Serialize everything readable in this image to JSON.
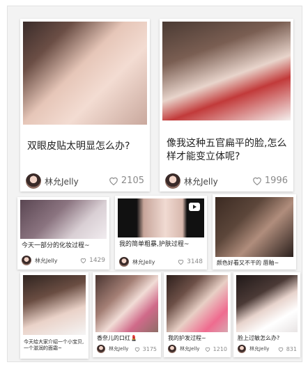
{
  "cards": [
    {
      "caption": "双眼皮贴太明显怎么办?",
      "author": "林允Jelly",
      "likes": "2105",
      "heart_icon": "heart-outline-icon"
    },
    {
      "caption": "像我这种五官扁平的脸,怎么样才能变立体呢?",
      "author": "林允Jelly",
      "likes": "1996",
      "heart_icon": "heart-outline-icon"
    },
    {
      "caption": "今天一部分的化妆过程~",
      "author": "林允Jelly",
      "likes": "1429",
      "heart_icon": "heart-outline-icon"
    },
    {
      "caption": "我的简单粗暴,护肤过程~",
      "author": "林允Jelly",
      "likes": "3148",
      "heart_icon": "heart-outline-icon",
      "video_icon": "play-icon"
    },
    {
      "caption": "颜色好看又不干的 唇釉~",
      "author": "",
      "likes": "",
      "heart_icon": ""
    },
    {
      "caption": "今天给大家介绍一个小宝贝,一个滋润的面霜~",
      "author": "",
      "likes": "",
      "heart_icon": ""
    },
    {
      "caption": "香奈儿的口红💄",
      "author": "林允Jelly",
      "likes": "3175",
      "heart_icon": "heart-outline-icon"
    },
    {
      "caption": "我的护发过程~",
      "author": "林允Jelly",
      "likes": "1210",
      "heart_icon": "heart-outline-icon"
    },
    {
      "caption": "脸上过敏怎么办?",
      "author": "林允Jelly",
      "likes": "831",
      "heart_icon": "heart-outline-icon"
    }
  ],
  "colors": {
    "background": "#f3f3f3",
    "card": "#ffffff",
    "text": "#222222",
    "muted": "#8a8a8a"
  }
}
